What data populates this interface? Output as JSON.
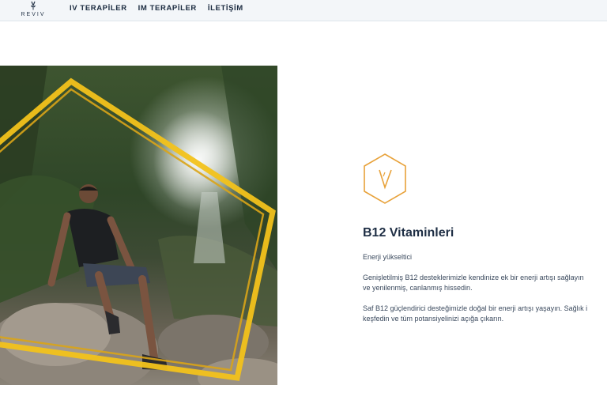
{
  "brand": {
    "name": "REVIV"
  },
  "nav": {
    "items": [
      "IV TERAPİLER",
      "IM TERAPİLER",
      "İLETİŞİM"
    ]
  },
  "product": {
    "title": "B12 Vitaminleri",
    "subtitle": "Enerji yükseltici",
    "paragraph1_line1": "Genişletilmiş B12 desteklerimizle kendinize ek bir enerji artışı sağlayın",
    "paragraph1_line2": "ve yenilenmiş, canlanmış hissedin.",
    "paragraph2_line1": "Saf B12 güçlendirici desteğimizle doğal bir enerji artışı yaşayın. Sağlık i",
    "paragraph2_line2": "keşfedin ve tüm potansiyelinizi açığa çıkarın."
  },
  "colors": {
    "accent": "#e8a23a",
    "frame": "#f2c21b",
    "text": "#1e2e44"
  },
  "icons": {
    "logo": "reviv-logo-icon",
    "product": "vitamin-hexagon-icon"
  }
}
